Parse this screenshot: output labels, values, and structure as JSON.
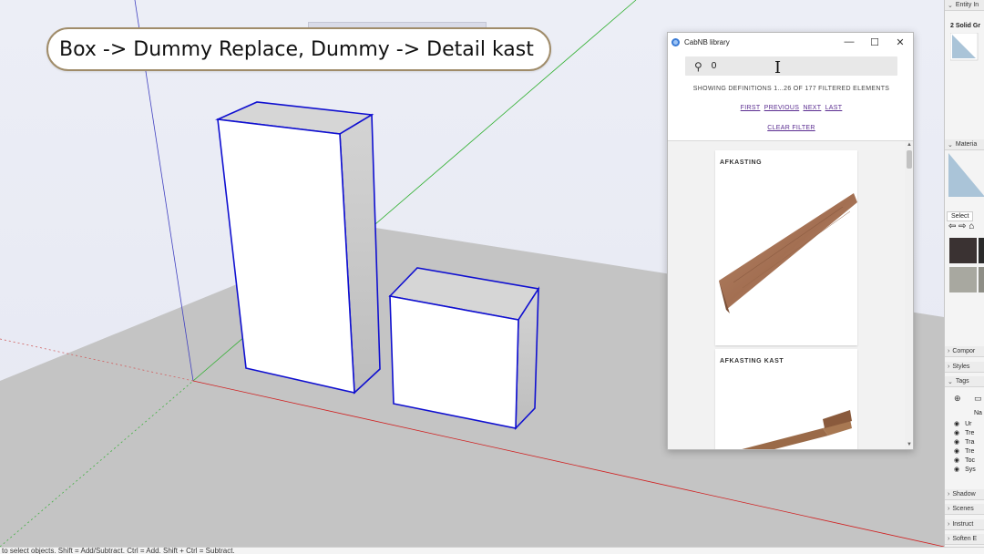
{
  "viewport": {
    "annotation": "Box -> Dummy Replace, Dummy -> Detail kast"
  },
  "library": {
    "window_title": "CabNB library",
    "search_value": "0",
    "showing_text": "SHOWING DEFINITIONS 1...26 OF 177 FILTERED ELEMENTS",
    "pager": {
      "first": "FIRST",
      "previous": "PREVIOUS",
      "next": "NEXT",
      "last": "LAST"
    },
    "clear_filter": "CLEAR FILTER",
    "items": [
      {
        "title": "AFKASTING"
      },
      {
        "title": "AFKASTING KAST"
      }
    ]
  },
  "right_panel": {
    "entity_info": "Entity In",
    "entity_sub": "2 Solid Gr",
    "materials": "Materia",
    "select_tab": "Select",
    "components": "Compor",
    "styles": "Styles",
    "tags": "Tags",
    "tags_header": "Na",
    "tag_rows": [
      "Ur",
      "Tre",
      "Tra",
      "Tre",
      "Toc",
      "Sys"
    ],
    "shadows": "Shadow",
    "scenes": "Scenes",
    "instructor": "Instruct",
    "soften": "Soften E"
  },
  "statusbar": {
    "text": "to select objects. Shift = Add/Subtract. Ctrl = Add. Shift + Ctrl = Subtract."
  }
}
